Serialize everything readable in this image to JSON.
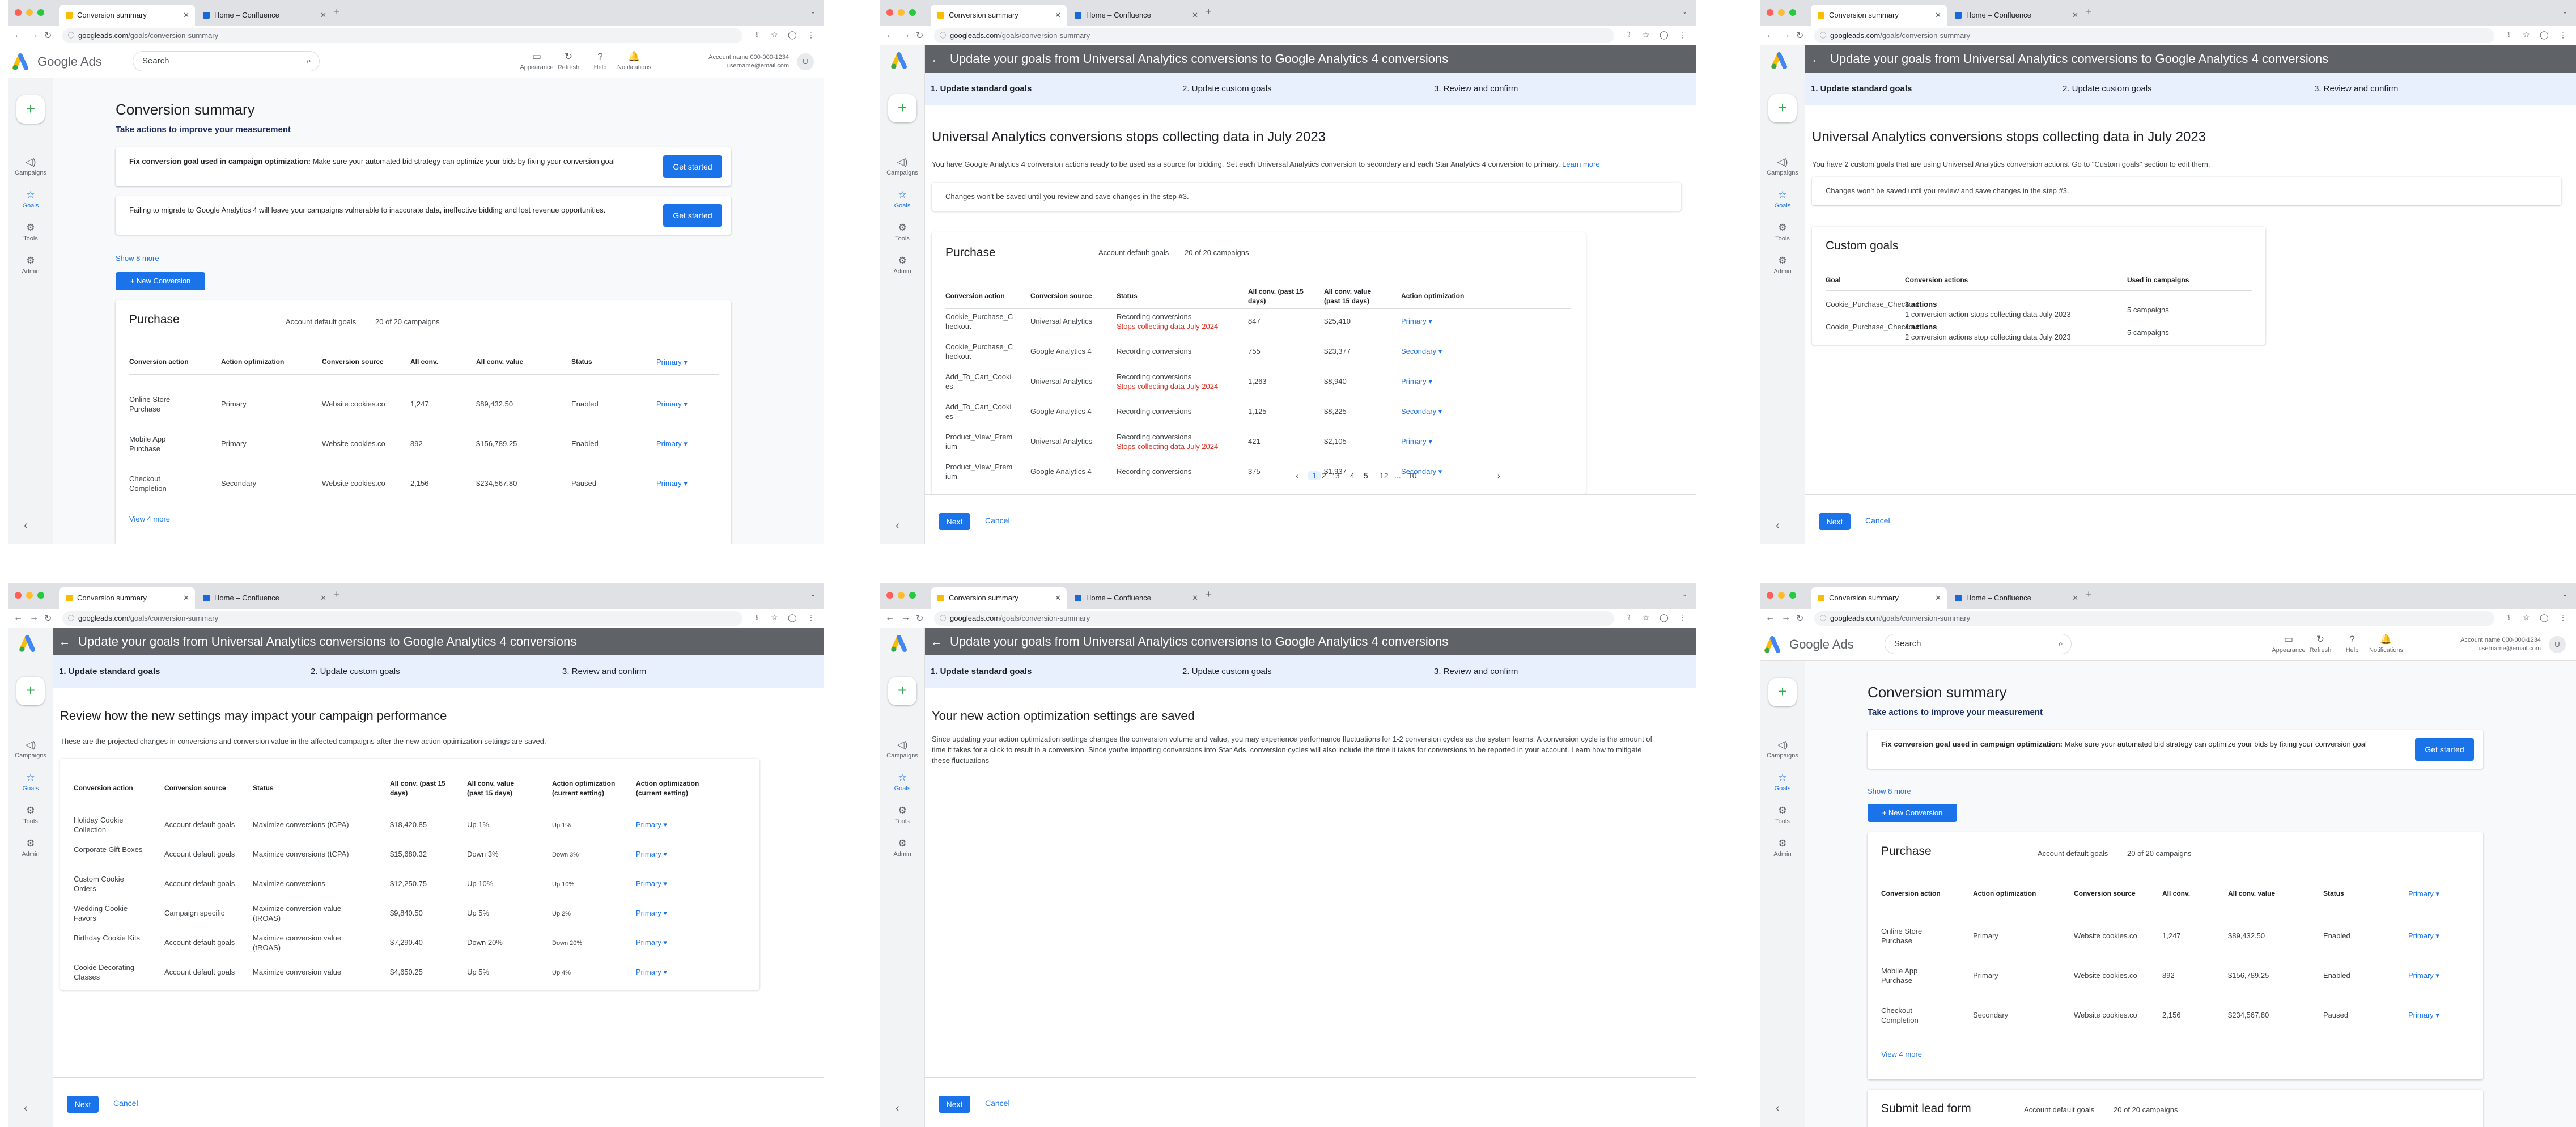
{
  "colors": {
    "primary": "#1a73e8",
    "error": "#d93025",
    "wizard_header": "#5f6368",
    "step_bar": "#e8f0fe"
  },
  "browser": {
    "active_tab": "Conversion summary",
    "other_tab": "Home – Confluence",
    "url_host": "googleads.com",
    "url_path": "/goals/conversion-summary"
  },
  "ads_header": {
    "product": "Google Ads",
    "search_placeholder": "Search",
    "tools": {
      "appearance": "Appearance",
      "refresh": "Refresh",
      "help": "Help",
      "notifications": "Notifications"
    },
    "account_name": "Account name 000-000-1234",
    "account_email": "username@email.com",
    "avatar": "U"
  },
  "sidebar": {
    "campaigns": "Campaigns",
    "goals": "Goals",
    "tools": "Tools",
    "admin": "Admin"
  },
  "summary": {
    "title": "Conversion summary",
    "subtitle": "Take actions to improve your measurement",
    "rec1_bold": "Fix conversion goal used in campaign optimization:",
    "rec1_text": "Make sure your automated bid strategy can optimize your bids by fixing your conversion goal",
    "rec2_text": "Failing to migrate to Google Analytics 4 will leave your campaigns vulnerable to inaccurate data, ineffective bidding and lost revenue opportunities.",
    "get_started": "Get started",
    "show_more": "Show 8 more",
    "new_conversion": "+ New Conversion",
    "purchase_title": "Purchase",
    "account_default_goals": "Account default goals",
    "campaigns_count": "20 of 20 campaigns",
    "headers": {
      "action": "Conversion action",
      "opt": "Action optimization",
      "source": "Conversion source",
      "conv": "All conv.",
      "value": "All conv. value",
      "status": "Status",
      "primary": "Primary"
    },
    "rows": [
      {
        "action": "Online Store Purchase",
        "opt": "Primary",
        "source": "Website cookies.co",
        "conv": "1,247",
        "value": "$89,432.50",
        "status": "Enabled",
        "primary": "Primary"
      },
      {
        "action": "Mobile App Purchase",
        "opt": "Primary",
        "source": "Website cookies.co",
        "conv": "892",
        "value": "$156,789.25",
        "status": "Enabled",
        "primary": "Primary"
      },
      {
        "action": "Checkout Completion",
        "opt": "Secondary",
        "source": "Website cookies.co",
        "conv": "2,156",
        "value": "$234,567.80",
        "status": "Paused",
        "primary": "Primary"
      }
    ],
    "view_more": "View 4 more",
    "lead_title": "Submit lead form"
  },
  "wizard": {
    "title": "Update your goals from Universal Analytics conversions to Google Analytics 4 conversions",
    "step1": "1. Update standard goals",
    "step2": "2. Update custom goals",
    "step3": "3. Review and confirm",
    "next": "Next",
    "cancel": "Cancel"
  },
  "standard": {
    "heading": "Universal Analytics conversions stops collecting data in July 2023",
    "body": "You have Google Analytics 4 conversion actions ready to be used as a source for bidding. Set each Universal Analytics conversion to secondary and each Star Analytics 4 conversion to primary.",
    "learn_more": "Learn more",
    "banner": "Changes won't be saved until you review and save changes in the step #3.",
    "purchase_title": "Purchase",
    "account_default_goals": "Account default goals",
    "campaigns_count": "20 of 20 campaigns",
    "headers": {
      "action": "Conversion action",
      "source": "Conversion source",
      "status": "Status",
      "conv": "All conv. (past 15 days)",
      "value": "All conv. value (past 15 days)",
      "opt": "Action optimization"
    },
    "rows": [
      {
        "action": "Cookie_Purchase_Checkout",
        "source": "Universal Analytics",
        "status": "Recording conversions",
        "warn": "Stops collecting data July 2024",
        "conv": "847",
        "value": "$25,410",
        "opt": "Primary"
      },
      {
        "action": "Cookie_Purchase_Checkout",
        "source": "Google Analytics 4",
        "status": "Recording conversions",
        "warn": "",
        "conv": "755",
        "value": "$23,377",
        "opt": "Secondary"
      },
      {
        "action": "Add_To_Cart_Cookies",
        "source": "Universal Analytics",
        "status": "Recording conversions",
        "warn": "Stops collecting data July 2024",
        "conv": "1,263",
        "value": "$8,940",
        "opt": "Primary"
      },
      {
        "action": "Add_To_Cart_Cookies",
        "source": "Google Analytics 4",
        "status": "Recording conversions",
        "warn": "",
        "conv": "1,125",
        "value": "$8,225",
        "opt": "Secondary"
      },
      {
        "action": "Product_View_Premium",
        "source": "Universal Analytics",
        "status": "Recording conversions",
        "warn": "Stops collecting data July 2024",
        "conv": "421",
        "value": "$2,105",
        "opt": "Primary"
      },
      {
        "action": "Product_View_Premium",
        "source": "Google Analytics 4",
        "status": "Recording conversions",
        "warn": "",
        "conv": "375",
        "value": "$1,937",
        "opt": "Secondary"
      }
    ],
    "pages": [
      "1",
      "2",
      "3",
      "4",
      "5",
      "12",
      "...",
      "10"
    ]
  },
  "custom": {
    "heading": "Universal Analytics conversions stops collecting data in July 2023",
    "body": "You have 2 custom goals that are using Universal Analytics conversion actions. Go to \"Custom goals\" section to edit them.",
    "banner": "Changes won't be saved until you review and save changes in the step #3.",
    "card_title": "Custom goals",
    "headers": {
      "goal": "Goal",
      "actions": "Conversion actions",
      "used": "Used in campaigns"
    },
    "rows": [
      {
        "goal": "Cookie_Purchase_Checkout",
        "count": "3 actions",
        "detail": "1 conversion action stops collecting data July 2023",
        "used": "5 campaigns"
      },
      {
        "goal": "Cookie_Purchase_Checkout",
        "count": "4 actions",
        "detail": "2 conversion actions stop collecting data July 2023",
        "used": "5 campaigns"
      }
    ]
  },
  "review": {
    "heading": "Review how the new settings may impact your campaign performance",
    "body": "These are the projected changes in conversions and conversion value in the affected campaigns after the new action optimization settings are saved.",
    "headers": {
      "action": "Conversion action",
      "source": "Conversion source",
      "status": "Status",
      "conv": "All conv. (past 15 days)",
      "value": "All conv. value (past 15 days)",
      "opt_cur": "Action optimization (current setting)",
      "opt_cur2": "Action optimization (current setting)"
    },
    "rows": [
      {
        "action": "Holiday Cookie Collection",
        "source": "Account default goals",
        "status": "Maximize conversions (tCPA)",
        "conv": "$18,420.85",
        "value": "Up 1%",
        "chip": "Up 1%",
        "opt": "Primary"
      },
      {
        "action": "Corporate Gift Boxes",
        "source": "Account default goals",
        "status": "Maximize conversions (tCPA)",
        "conv": "$15,680.32",
        "value": "Down 3%",
        "chip": "Down 3%",
        "opt": "Primary"
      },
      {
        "action": "Custom Cookie Orders",
        "source": "Account default goals",
        "status": "Maximize conversions",
        "conv": "$12,250.75",
        "value": "Up 10%",
        "chip": "Up 10%",
        "opt": "Primary"
      },
      {
        "action": "Wedding Cookie Favors",
        "source": "Campaign specific",
        "status": "Maximize conversion value (tROAS)",
        "conv": "$9,840.50",
        "value": "Up 5%",
        "chip": "Up 2%",
        "opt": "Primary"
      },
      {
        "action": "Birthday Cookie Kits",
        "source": "Account default goals",
        "status": "Maximize conversion value (tROAS)",
        "conv": "$7,290.40",
        "value": "Down 20%",
        "chip": "Down 20%",
        "opt": "Primary"
      },
      {
        "action": "Cookie Decorating Classes",
        "source": "Account default goals",
        "status": "Maximize conversion value",
        "conv": "$4,650.25",
        "value": "Up 5%",
        "chip": "Up 4%",
        "opt": "Primary"
      }
    ]
  },
  "saved": {
    "heading": "Your new action optimization settings are saved",
    "body": "Since updating your action optimization settings changes the conversion volume and value, you may experience performance fluctuations for 1-2 conversion cycles as the system learns. A conversion cycle is the amount of time it takes for a click to result in a conversion. Since you're importing conversions into Star Ads, conversion cycles will also include the time it takes for conversions to be reported in your account. Learn how to mitigate these fluctuations"
  }
}
